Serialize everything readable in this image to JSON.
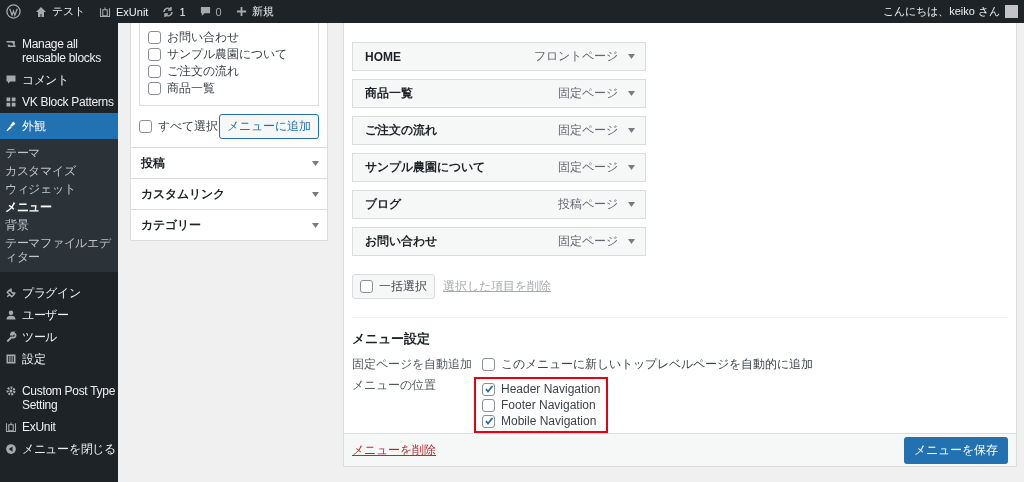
{
  "admin_bar": {
    "site_name": "テスト",
    "plugin": "ExUnit",
    "updates": "1",
    "comments": "0",
    "new": "新規",
    "greeting": "こんにちは、keiko さん"
  },
  "sidebar": {
    "items": [
      {
        "label": "Manage all reusable blocks",
        "selected": false
      },
      {
        "label": "コメント",
        "selected": false
      },
      {
        "label": "VK Block Patterns",
        "selected": false
      },
      {
        "label": "外観",
        "selected": true,
        "children": [
          {
            "label": "テーマ",
            "selected": false
          },
          {
            "label": "カスタマイズ",
            "selected": false
          },
          {
            "label": "ウィジェット",
            "selected": false
          },
          {
            "label": "メニュー",
            "selected": true
          },
          {
            "label": "背景",
            "selected": false
          },
          {
            "label": "テーマファイルエディター",
            "selected": false
          }
        ]
      },
      {
        "label": "プラグイン",
        "selected": false
      },
      {
        "label": "ユーザー",
        "selected": false
      },
      {
        "label": "ツール",
        "selected": false
      },
      {
        "label": "設定",
        "selected": false
      },
      {
        "label": "Custom Post Type Setting",
        "selected": false
      },
      {
        "label": "ExUnit",
        "selected": false
      },
      {
        "label": "メニューを閉じる",
        "selected": false
      }
    ]
  },
  "add_items": {
    "pages": [
      {
        "label": "お問い合わせ",
        "checked": false
      },
      {
        "label": "サンプル農園について",
        "checked": false
      },
      {
        "label": "ご注文の流れ",
        "checked": false
      },
      {
        "label": "商品一覧",
        "checked": false
      }
    ],
    "select_all": {
      "label": "すべて選択",
      "checked": false
    },
    "add_button": "メニューに追加",
    "sections": [
      {
        "title": "投稿"
      },
      {
        "title": "カスタムリンク"
      },
      {
        "title": "カテゴリー"
      }
    ]
  },
  "menu_structure": {
    "items": [
      {
        "title": "HOME",
        "type": "フロントページ"
      },
      {
        "title": "商品一覧",
        "type": "固定ページ"
      },
      {
        "title": "ご注文の流れ",
        "type": "固定ページ"
      },
      {
        "title": "サンプル農園について",
        "type": "固定ページ"
      },
      {
        "title": "ブログ",
        "type": "投稿ページ"
      },
      {
        "title": "お問い合わせ",
        "type": "固定ページ"
      }
    ],
    "bulk_select": {
      "label": "一括選択",
      "checked": false
    },
    "delete_selected": "選択した項目を削除"
  },
  "menu_settings": {
    "heading": "メニュー設定",
    "auto_add": {
      "label": "固定ページを自動追加",
      "option": "このメニューに新しいトップレベルページを自動的に追加",
      "checked": false
    },
    "locations": {
      "label": "メニューの位置",
      "highlighted": true,
      "options": [
        {
          "label": "Header Navigation",
          "checked": true
        },
        {
          "label": "Footer Navigation",
          "checked": false
        },
        {
          "label": "Mobile Navigation",
          "checked": true
        }
      ]
    }
  },
  "footer": {
    "delete_link": "メニューを削除",
    "save_button": "メニューを保存"
  }
}
